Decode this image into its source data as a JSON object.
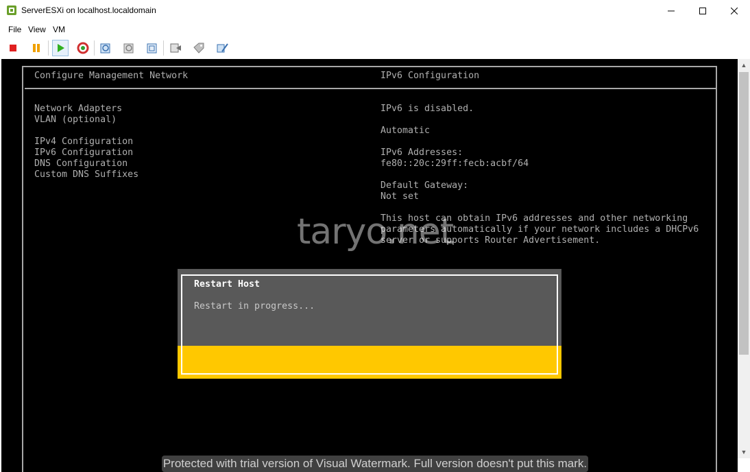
{
  "window": {
    "title": "ServerESXi on localhost.localdomain",
    "controls": {
      "minimize": "minimize",
      "maximize": "maximize",
      "close": "close"
    }
  },
  "menu": {
    "items": [
      "File",
      "View",
      "VM"
    ]
  },
  "toolbar": {
    "buttons": [
      "power-off",
      "suspend",
      "power-on",
      "reset",
      "snapshot",
      "revert-snapshot",
      "manage-snapshots",
      "send-ctrl-alt-del",
      "vm-settings",
      "edit-settings"
    ]
  },
  "console": {
    "left_title": "Configure Management Network",
    "right_title": "IPv6 Configuration",
    "menu_items": [
      "Network Adapters",
      "VLAN (optional)",
      "IPv4 Configuration",
      "IPv6 Configuration",
      "DNS Configuration",
      "Custom DNS Suffixes"
    ],
    "details": {
      "status": "IPv6 is disabled.",
      "mode": "Automatic",
      "addresses_label": "IPv6 Addresses:",
      "address": "fe80::20c:29ff:fecb:acbf/64",
      "gateway_label": "Default Gateway:",
      "gateway": "Not set",
      "desc_line1": "This host can obtain IPv6 addresses and other networking",
      "desc_line2": "parameters automatically if your network includes a DHCPv6",
      "desc_line3": "server or supports Router Advertisement."
    }
  },
  "dialog": {
    "title": "Restart Host",
    "message": "Restart in progress..."
  },
  "watermarks": {
    "site": "taryo.net",
    "notice": "Protected with trial version of Visual Watermark. Full version doesn't put this mark."
  },
  "colors": {
    "console_bg": "#000000",
    "console_text": "#b0b0b0",
    "dialog_bg": "#595959",
    "dialog_bar": "#ffc800"
  }
}
